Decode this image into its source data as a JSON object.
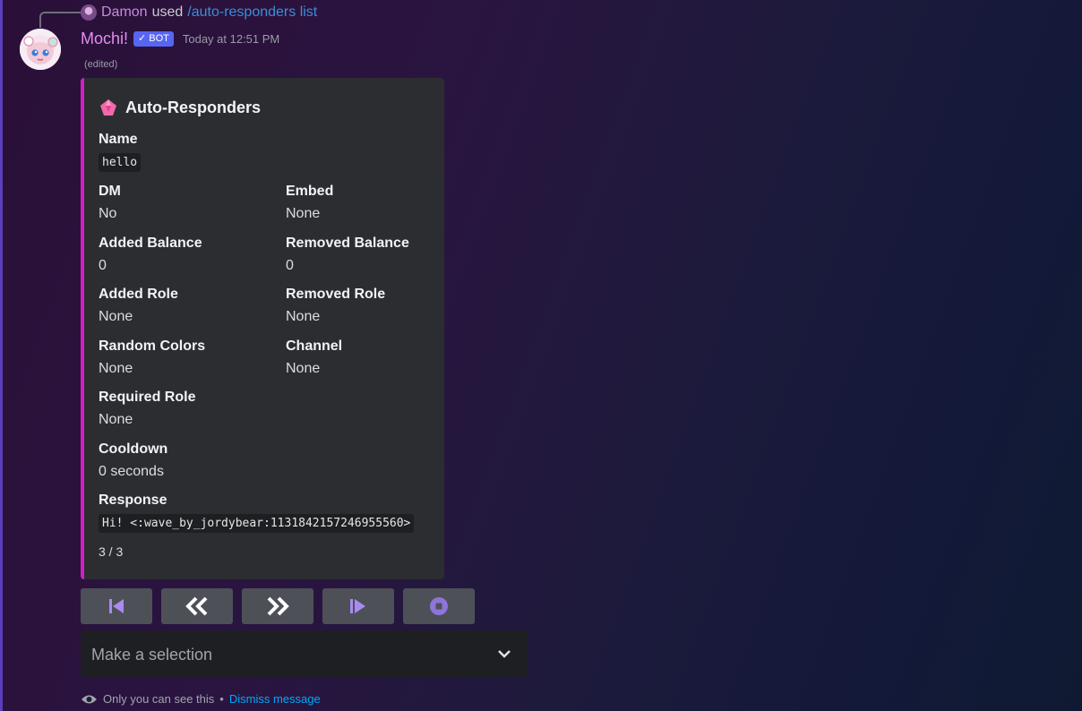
{
  "reply": {
    "username": "Damon",
    "used_text": "used",
    "command": "/auto-responders list"
  },
  "message": {
    "bot_name": "Mochi!",
    "bot_tag": "BOT",
    "timestamp": "Today at 12:51 PM",
    "edited": "(edited)"
  },
  "embed": {
    "accent_color": "#d11fc4",
    "icon": "pink-gem-icon",
    "title": "Auto-Responders",
    "fields": {
      "name": {
        "label": "Name",
        "value": "hello"
      },
      "dm": {
        "label": "DM",
        "value": "No"
      },
      "embed": {
        "label": "Embed",
        "value": "None"
      },
      "added_balance": {
        "label": "Added Balance",
        "value": "0"
      },
      "removed_balance": {
        "label": "Removed Balance",
        "value": "0"
      },
      "added_role": {
        "label": "Added Role",
        "value": "None"
      },
      "removed_role": {
        "label": "Removed Role",
        "value": "None"
      },
      "random_colors": {
        "label": "Random Colors",
        "value": "None"
      },
      "channel": {
        "label": "Channel",
        "value": "None"
      },
      "required_role": {
        "label": "Required Role",
        "value": "None"
      },
      "cooldown": {
        "label": "Cooldown",
        "value": "0 seconds"
      },
      "response": {
        "label": "Response",
        "value": "Hi! <:wave_by_jordybear:1131842157246955560>"
      }
    },
    "footer": "3 / 3"
  },
  "buttons": [
    {
      "icon": "first-page-icon"
    },
    {
      "icon": "previous-page-icon"
    },
    {
      "icon": "next-page-icon"
    },
    {
      "icon": "last-page-icon"
    },
    {
      "icon": "stop-icon"
    }
  ],
  "select": {
    "placeholder": "Make a selection",
    "icon": "chevron-down-icon"
  },
  "ephemeral": {
    "icon": "eye-icon",
    "text": "Only you can see this",
    "separator": "•",
    "dismiss": "Dismiss message"
  }
}
